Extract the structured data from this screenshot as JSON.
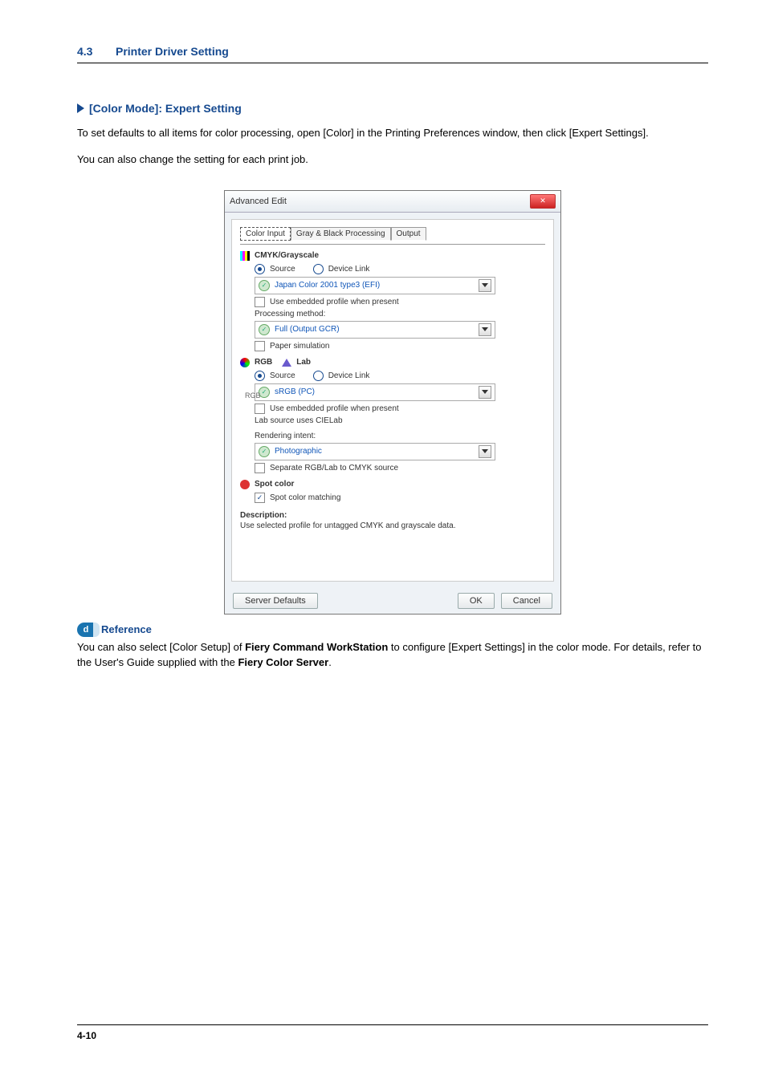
{
  "header": {
    "section_number": "4.3",
    "section_title": "Printer Driver Setting"
  },
  "section": {
    "title": "[Color Mode]: Expert Setting"
  },
  "paragraphs": {
    "p1": "To set defaults to all items for color processing, open [Color] in the Printing Preferences window, then click [Expert Settings].",
    "p2": "You can also change the setting for each print job."
  },
  "dialog": {
    "title": "Advanced Edit",
    "close_glyph": "✕",
    "tabs": {
      "t1": "Color Input",
      "t2": "Gray & Black Processing",
      "t3": "Output"
    },
    "cmyk": {
      "heading": "CMYK/Grayscale",
      "source_label": "Source",
      "devlink_label": "Device Link",
      "profile": "Japan Color 2001 type3 (EFI)",
      "embedded": "Use embedded profile when present",
      "proc_label": "Processing method:",
      "proc_value": "Full (Output GCR)",
      "paper_sim": "Paper simulation"
    },
    "rgb": {
      "heading_rgb": "RGB",
      "heading_lab": "Lab",
      "side_label": "RGB",
      "source_label": "Source",
      "devlink_label": "Device Link",
      "profile": "sRGB (PC)",
      "embedded": "Use embedded profile when present",
      "lab_src": "Lab source uses CIELab",
      "ri_label": "Rendering intent:",
      "ri_value": "Photographic",
      "separate": "Separate RGB/Lab to CMYK source"
    },
    "spot": {
      "heading": "Spot color",
      "matching": "Spot color matching"
    },
    "description": {
      "title": "Description:",
      "body": "Use selected profile for untagged CMYK and grayscale data."
    },
    "buttons": {
      "defaults": "Server Defaults",
      "ok": "OK",
      "cancel": "Cancel"
    }
  },
  "reference": {
    "label": "Reference",
    "text_before": "You can also select [Color Setup] of ",
    "bold1": "Fiery Command WorkStation",
    "text_mid": " to configure [Expert Settings] in the color mode. For details, refer to the User's Guide supplied with the ",
    "bold2": "Fiery Color Server",
    "tail": "."
  },
  "footer": {
    "page": "4-10"
  }
}
